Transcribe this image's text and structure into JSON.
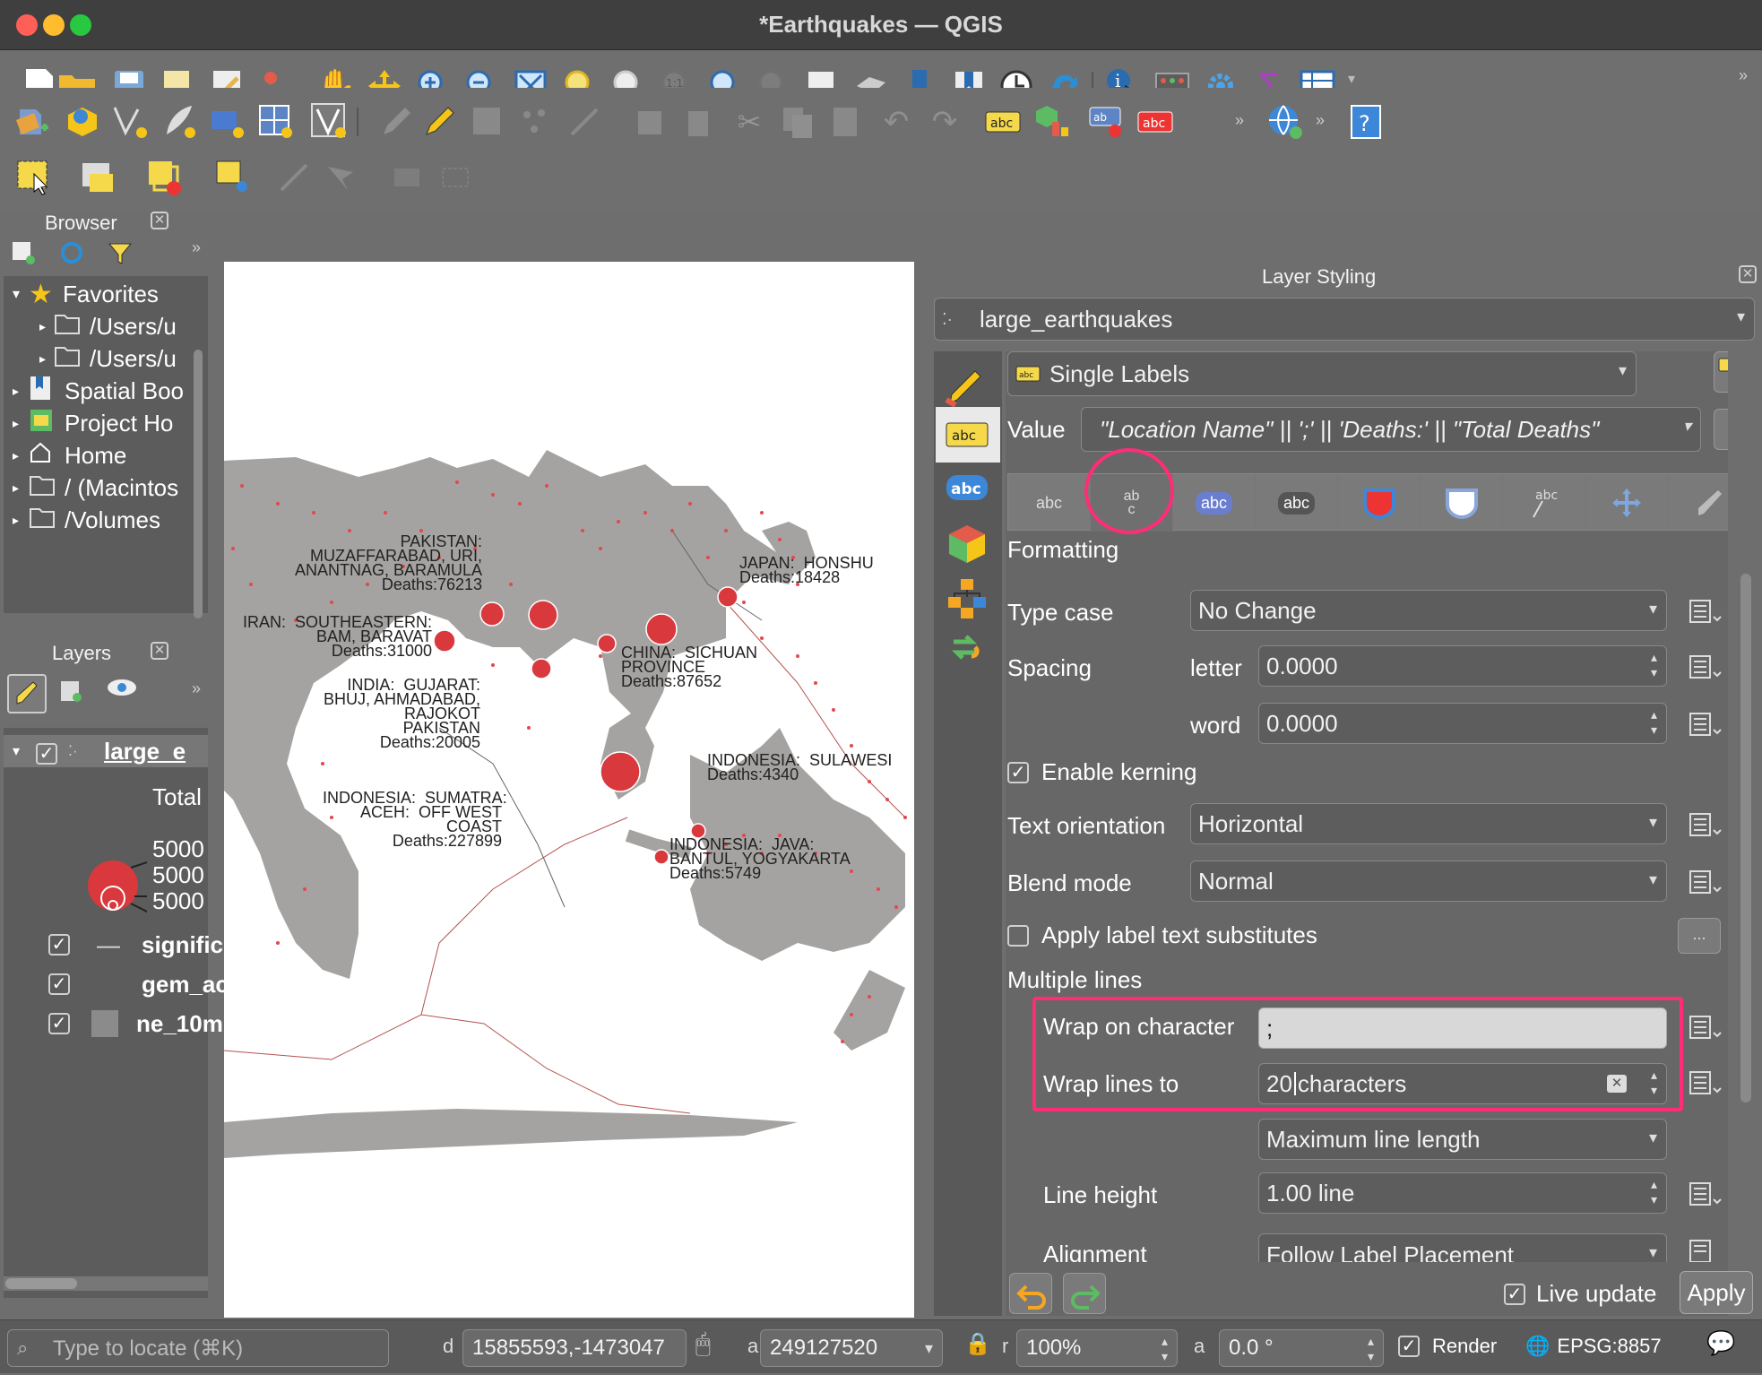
{
  "window": {
    "title": "*Earthquakes — QGIS"
  },
  "browser": {
    "title": "Browser",
    "items": [
      {
        "label": "Favorites",
        "icon": "star-icon"
      },
      {
        "label": "/Users/u",
        "icon": "folder-icon"
      },
      {
        "label": "/Users/u",
        "icon": "folder-icon"
      },
      {
        "label": "Spatial Boo",
        "icon": "bookmark-icon"
      },
      {
        "label": "Project Ho",
        "icon": "project-icon"
      },
      {
        "label": "Home",
        "icon": "home-icon"
      },
      {
        "label": "/ (Macintos",
        "icon": "folder-icon"
      },
      {
        "label": "/Volumes",
        "icon": "folder-icon"
      }
    ]
  },
  "layers": {
    "title": "Layers",
    "layer_name": "large_e",
    "legend_title": "Total",
    "legend_values": [
      "5000",
      "5000",
      "5000"
    ],
    "others": [
      {
        "label": "signific"
      },
      {
        "label": "gem_ac"
      },
      {
        "label": "ne_10m"
      }
    ]
  },
  "map": {
    "labels": [
      {
        "text": "PAKISTAN:\nMUZAFFARABAD, URI,\nANANTNAG, BARAMULA\nDeaths:76213"
      },
      {
        "text": "JAPAN:  HONSHU\nDeaths:18428"
      },
      {
        "text": "IRAN:  SOUTHEASTERN:\nBAM, BARAVAT\nDeaths:31000"
      },
      {
        "text": "CHINA:  SICHUAN\nPROVINCE\nDeaths:87652"
      },
      {
        "text": "INDIA:  GUJARAT:\nBHUJ, AHMADABAD,\nRAJOKOT\nPAKISTAN\nDeaths:20005"
      },
      {
        "text": "INDONESIA:  SULAWESI\nDeaths:4340"
      },
      {
        "text": "INDONESIA:  SUMATRA:\nACEH:  OFF WEST\nCOAST\nDeaths:227899"
      },
      {
        "text": "INDONESIA:  JAVA:\nBANTUL, YOGYAKARTA\nDeaths:5749"
      }
    ]
  },
  "styling": {
    "title": "Layer Styling",
    "layer": "large_earthquakes",
    "renderer": "Single Labels",
    "value_label": "Value",
    "value_expr": "\"Location Name\" || ';' || 'Deaths:' || \"Total Deaths\"",
    "tabs": [
      "abc",
      "ab\nc",
      "abc",
      "abc"
    ],
    "section": "Formatting",
    "type_case_label": "Type case",
    "type_case": "No Change",
    "spacing_label": "Spacing",
    "letter_label": "letter",
    "letter_value": "0.0000",
    "word_label": "word",
    "word_value": "0.0000",
    "kerning_label": "Enable kerning",
    "orientation_label": "Text orientation",
    "orientation": "Horizontal",
    "blend_label": "Blend mode",
    "blend": "Normal",
    "substitutes_label": "Apply label text substitutes",
    "substitutes_button": "...",
    "multiline_label": "Multiple lines",
    "wrap_char_label": "Wrap on character",
    "wrap_char": ";",
    "wrap_lines_label": "Wrap lines to",
    "wrap_lines_value": "20",
    "wrap_lines_unit": "characters",
    "wrap_mode": "Maximum line length",
    "line_height_label": "Line height",
    "line_height": "1.00 line",
    "alignment_label": "Alignment",
    "alignment": "Follow Label Placement",
    "live_update_label": "Live update",
    "apply_label": "Apply"
  },
  "statusbar": {
    "locate_placeholder": "Type to locate (⌘K)",
    "coord_label": "d",
    "coordinate": "15855593,-1473047",
    "scale_label": "a",
    "scale": "249127520",
    "mag_label": "r",
    "magnifier": "100%",
    "rot_label": "a",
    "rotation": "0.0 °",
    "render_label": "Render",
    "crs": "EPSG:8857"
  },
  "colors": {
    "highlight": "#ff2d78",
    "quake_red": "#d9383d"
  }
}
